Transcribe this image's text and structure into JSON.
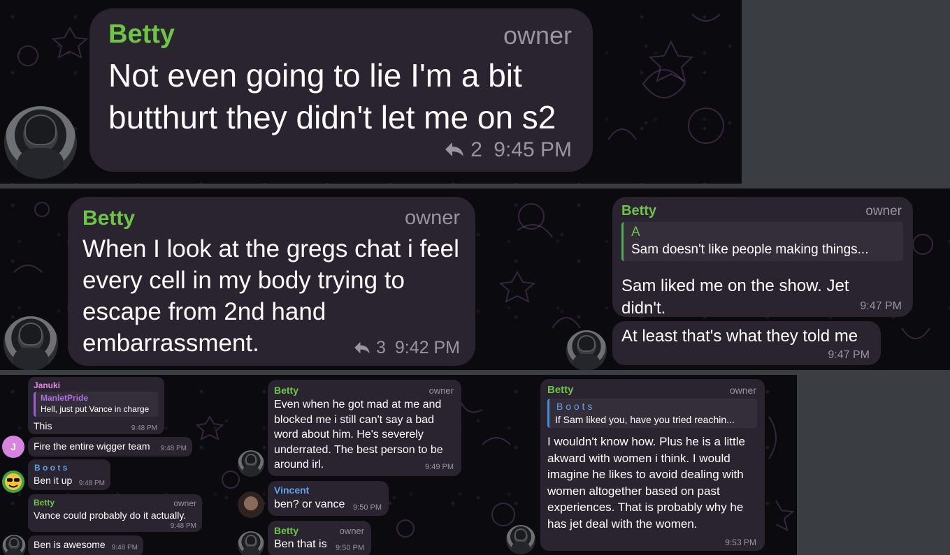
{
  "panel1": {
    "name": "Betty",
    "role": "owner",
    "message": "Not even going to lie I'm a bit butthurt they didn't let me on s2",
    "reply_count": "2",
    "time": "9:45 PM"
  },
  "panel2": {
    "left": {
      "name": "Betty",
      "role": "owner",
      "message": "When I look at the gregs chat i feel every cell in my body trying to escape from 2nd hand embarrassment.",
      "reply_count": "3",
      "time": "9:42 PM"
    },
    "right": {
      "name": "Betty",
      "role": "owner",
      "quote_author": "A",
      "quote_text": "Sam doesn't like people making things...",
      "message": "Sam liked me on the show. Jet didn't.",
      "time": "9:47 PM",
      "followup": "At least that's what they told me",
      "followup_time": "9:47 PM"
    }
  },
  "panel3": {
    "col1": {
      "januki_name": "Januki",
      "quote_author": "ManletPride",
      "quote_text": "Hell, just put Vance in charge",
      "msg1": "This",
      "msg1_time": "9:48 PM",
      "msg2": "Fire the entire wigger team",
      "msg2_time": "9:48 PM",
      "avatar_letter": "J",
      "boots_name": "B o o t s",
      "boots_msg": "Ben it up",
      "boots_time": "9:48 PM",
      "betty_name": "Betty",
      "betty_role": "owner",
      "betty_msg": "Vance could probably do it actually.",
      "betty_time": "9:48 PM",
      "betty_msg2": "Ben is awesome",
      "betty_time2": "9:48 PM"
    },
    "col2": {
      "betty_name": "Betty",
      "betty_role": "owner",
      "betty_msg": "Even when he got mad at me and blocked me i still can't say a bad word about him. He's severely underrated. The best person to be around irl.",
      "betty_time": "9:49 PM",
      "vincent_name": "Vincent",
      "vincent_msg": "ben? or vance",
      "vincent_time": "9:50 PM",
      "betty2_name": "Betty",
      "betty2_role": "owner",
      "betty2_msg": "Ben that is",
      "betty2_time": "9:50 PM"
    },
    "col3": {
      "betty_name": "Betty",
      "betty_role": "owner",
      "quote_author": "B o o t s",
      "quote_text": "If Sam liked you, have you tried reachin...",
      "message": "I wouldn't know how. Plus he is a little akward with women i think. I would imagine he likes to avoid dealing with women altogether based on past experiences. That is probably why he has jet deal with the women.",
      "time": "9:53 PM"
    }
  }
}
